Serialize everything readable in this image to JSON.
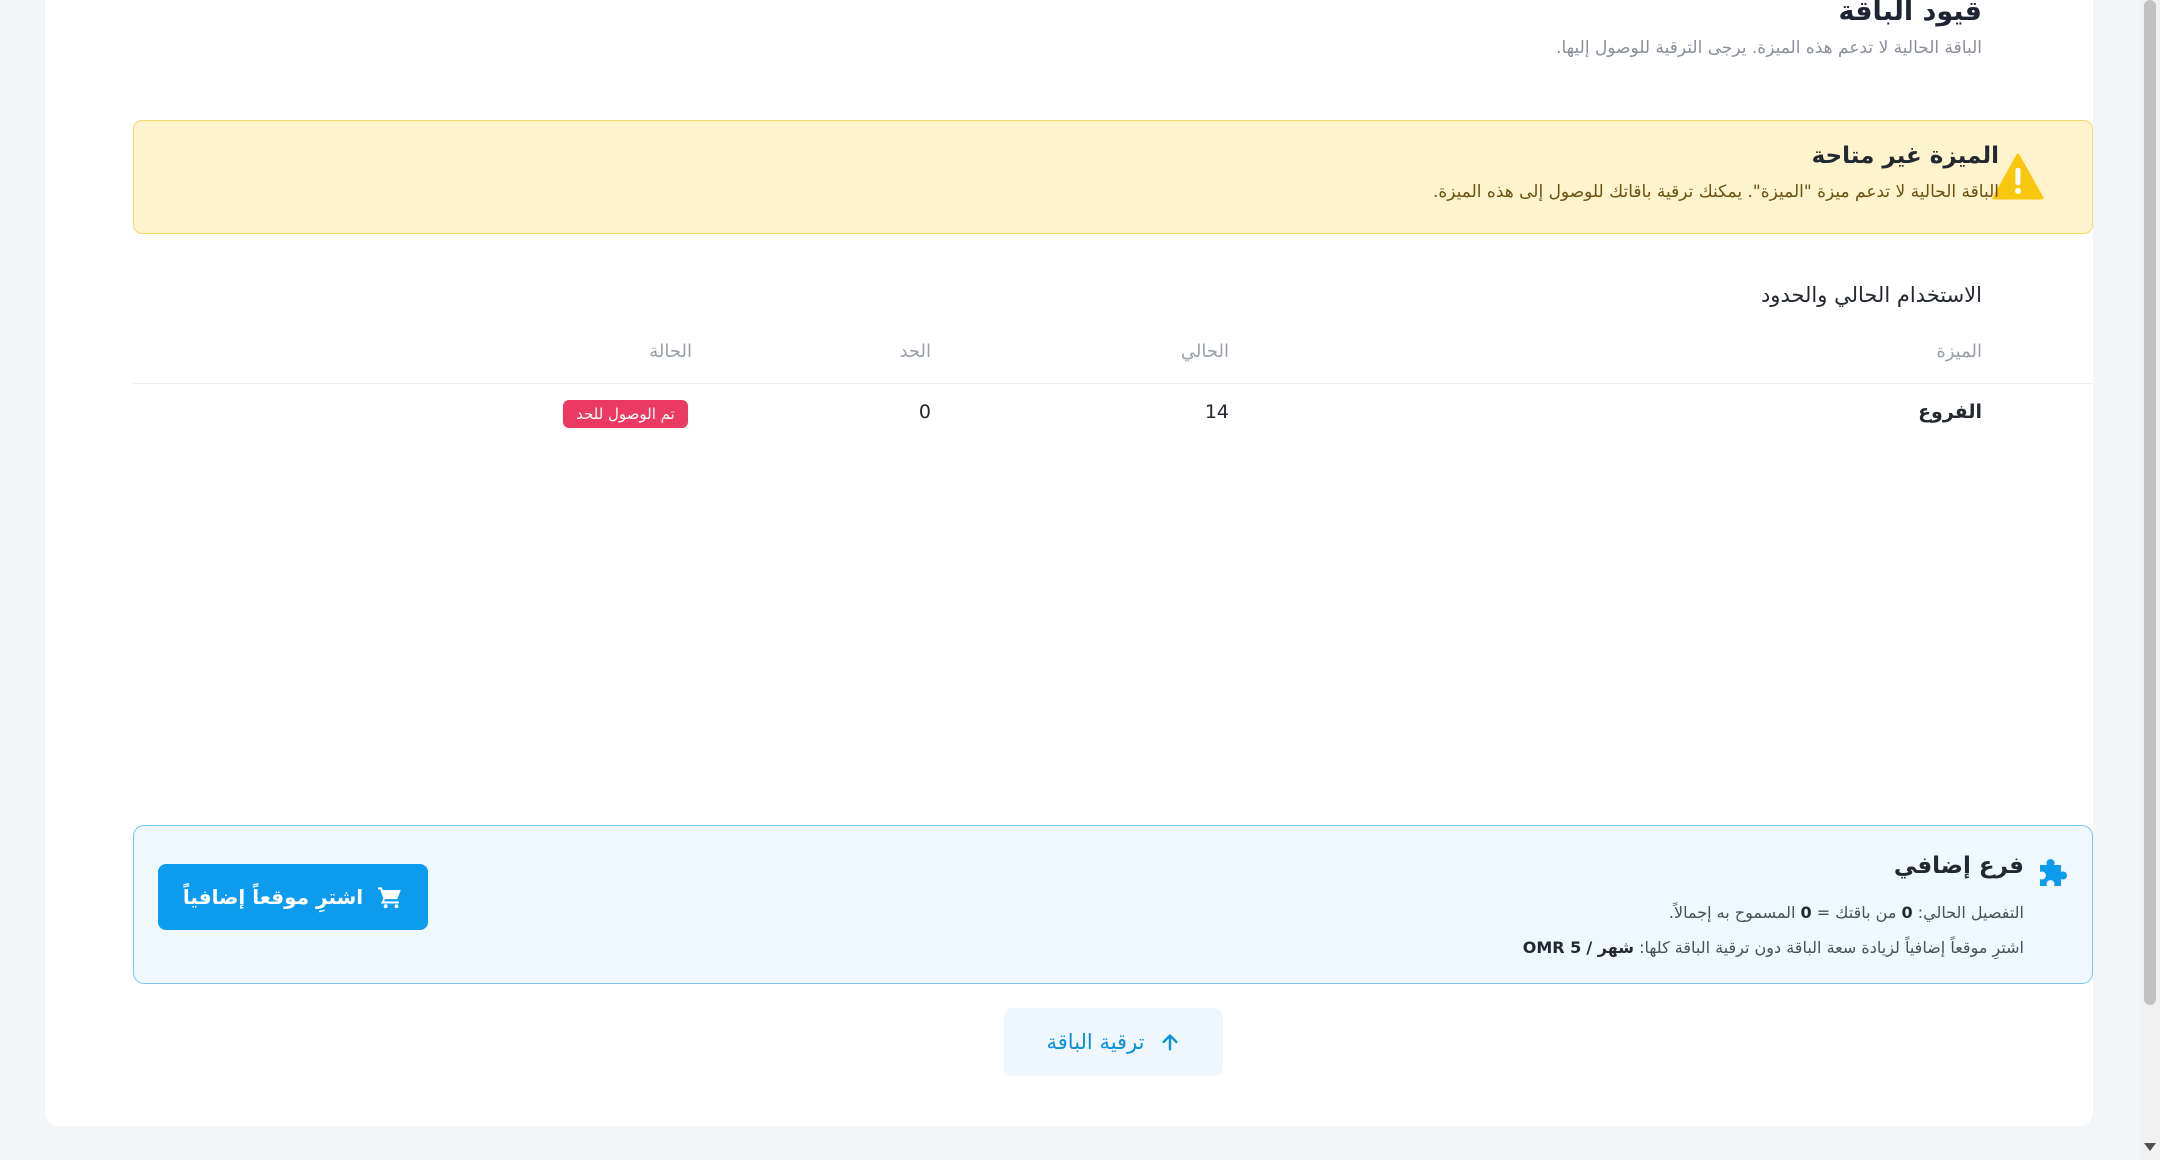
{
  "header": {
    "title": "قيود الباقة",
    "subtitle": "الباقة الحالية لا تدعم هذه الميزة. يرجى الترقية للوصول إليها."
  },
  "alert": {
    "icon": "warning-triangle-icon",
    "title": "الميزة غير متاحة",
    "text": "الباقة الحالية لا تدعم ميزة \"الميزة\". يمكنك ترقية باقاتك للوصول إلى هذه الميزة."
  },
  "usage": {
    "title": "الاستخدام الحالي والحدود",
    "headers": [
      "الميزة",
      "الحالي",
      "الحد",
      "الحالة"
    ],
    "rows": [
      {
        "feature": "الفروع",
        "current": "14",
        "limit": "0",
        "status": "تم الوصول للحد"
      }
    ]
  },
  "addon": {
    "icon": "puzzle-icon",
    "title": "فرع إضافي",
    "line1_prefix": "التفصيل الحالي:",
    "line1_used": "0",
    "line1_middle": "من باقتك =",
    "line1_allowed": "0",
    "line1_suffix": "المسموح به إجمالاً.",
    "line2_text": "اشترِ موقعاً إضافياً لزيادة سعة الباقة دون ترقية الباقة كلها:",
    "line2_period": "شهر /",
    "line2_price": "5 OMR",
    "button_label": "اشترِ موقعاً إضافياً",
    "button_icon": "cart-icon"
  },
  "upgrade": {
    "label": "ترقية الباقة",
    "icon": "arrow-up-icon"
  },
  "colors": {
    "accent": "#0d9ced",
    "danger": "#ea3a62",
    "warning": "#f9c80e",
    "warning_bg": "#fdf3cd",
    "info_bg": "#eef8fe"
  }
}
